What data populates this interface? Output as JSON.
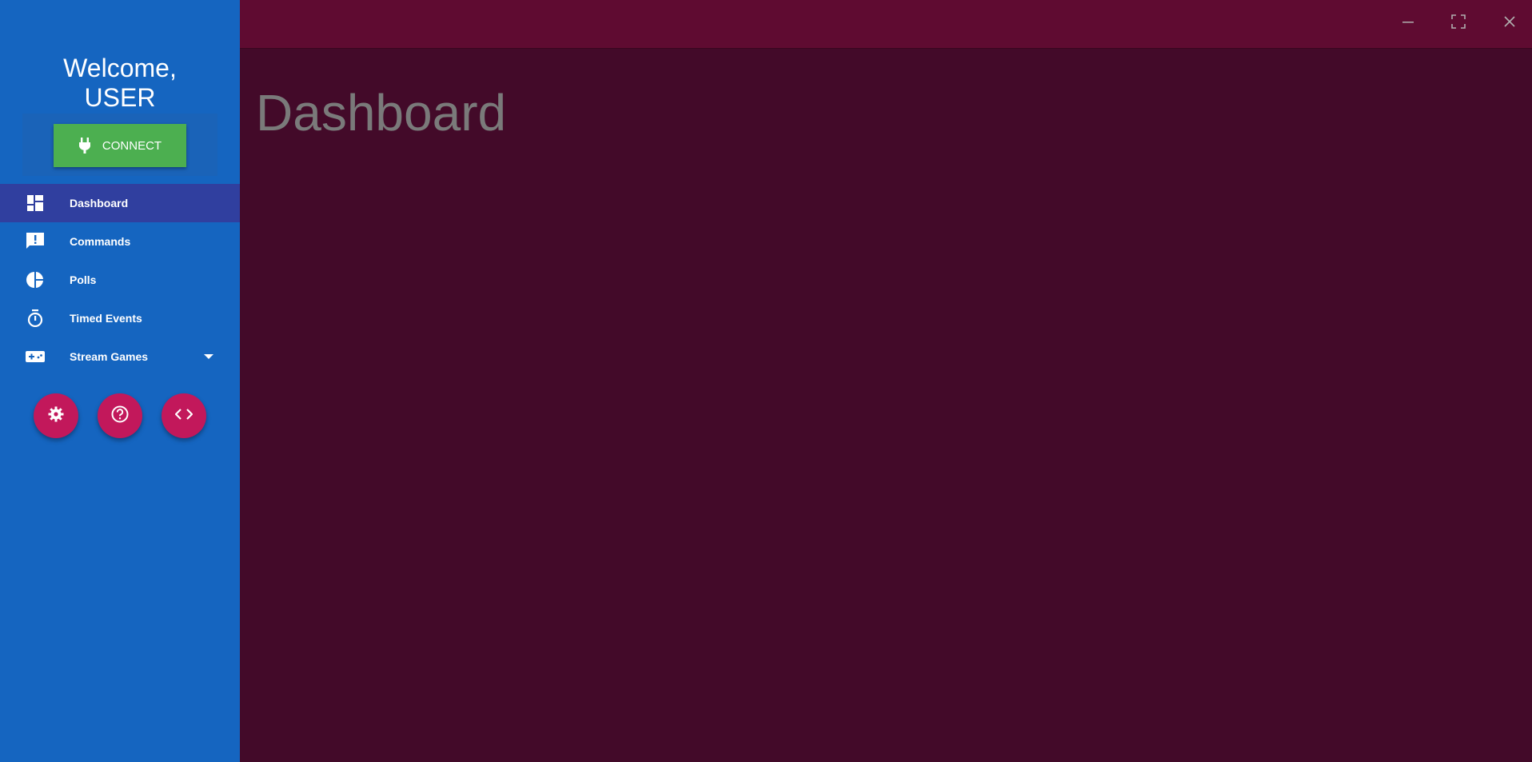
{
  "sidebar": {
    "welcome_line1": "Welcome,",
    "welcome_line2": "USER",
    "connect_label": "CONNECT",
    "items": [
      {
        "label": "Dashboard",
        "icon": "dashboard-icon",
        "active": true
      },
      {
        "label": "Commands",
        "icon": "chat-alert-icon"
      },
      {
        "label": "Polls",
        "icon": "pie-chart-icon"
      },
      {
        "label": "Timed Events",
        "icon": "timer-icon"
      },
      {
        "label": "Stream Games",
        "icon": "gamepad-icon",
        "expandable": true
      }
    ],
    "fabs": [
      {
        "icon": "gear-icon"
      },
      {
        "icon": "help-icon"
      },
      {
        "icon": "code-icon"
      }
    ]
  },
  "titlebar": {
    "controls": [
      "minimize-icon",
      "maximize-icon",
      "close-icon"
    ]
  },
  "main": {
    "title": "Dashboard"
  },
  "colors": {
    "sidebar": "#1565c0",
    "active_item": "#303f9f",
    "connect_button": "#4caf50",
    "fab": "#c2185b",
    "titlebar": "#5f0b31",
    "content_bg": "#430a29"
  }
}
